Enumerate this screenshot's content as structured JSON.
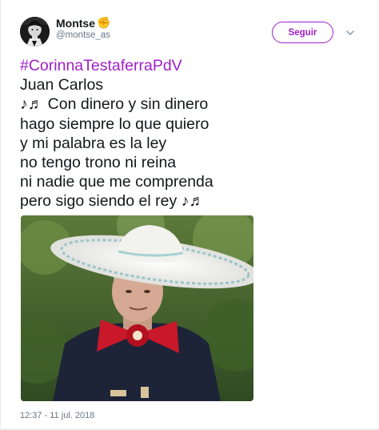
{
  "user": {
    "name": "Montse",
    "name_emoji": "✊",
    "handle": "@montse_as",
    "avatar_icon": "avatar-icon"
  },
  "actions": {
    "follow_label": "Seguir",
    "menu_icon": "chevron-down-icon"
  },
  "colors": {
    "accent": "#a020c8",
    "text": "#14171a",
    "secondary": "#657786"
  },
  "tweet": {
    "hashtag": "#CorinnaTestaferraPdV",
    "lines": [
      "Juan Carlos",
      "♪♬ Con dinero y sin dinero",
      "hago siempre lo que quiero",
      "y mi palabra es la ley",
      "no tengo trono ni reina",
      "ni nadie que me comprenda",
      "pero sigo siendo el rey ♪♬"
    ],
    "timestamp": "12:37 - 11 jul. 2018"
  },
  "media": {
    "image_icon": "photo-icon"
  }
}
